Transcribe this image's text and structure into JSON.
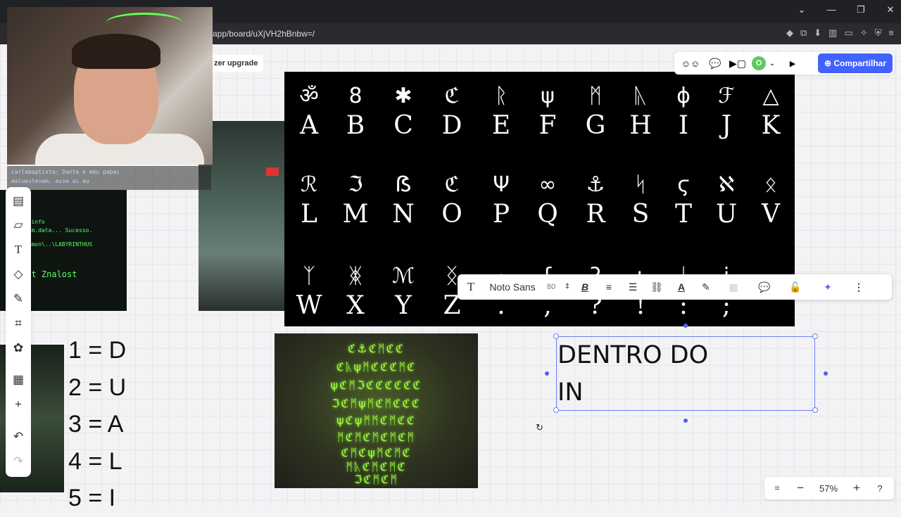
{
  "browser": {
    "url": "app/board/uXjVH2hBnbw=/",
    "window_controls": [
      "⌄",
      "—",
      "❐",
      "✕"
    ],
    "ext_icons": [
      "◆",
      "⧉",
      "⬇",
      "▥",
      "▭",
      "✧",
      "⛨",
      "≡"
    ]
  },
  "board": {
    "upgrade_label": "zer upgrade",
    "share_label": "Compartilhar",
    "avatar_initial": "O",
    "zoom_level": "57%"
  },
  "chat": {
    "line1": "carlabaptista: Dante é meu papai",
    "line2": "maluestevam: esse ai eu"
  },
  "terminal": {
    "lines": [
      "...info",
      "item.data... Sucesso.",
      "common\\..\\LABYRINTHUS"
    ],
    "big_text": "ost Znalost"
  },
  "mapping": {
    "lines": [
      "1 = D",
      "2 = U",
      "3 = A",
      "4 = L",
      "5 = I"
    ]
  },
  "alphabet": {
    "row1": [
      {
        "g": "ॐ",
        "l": "A"
      },
      {
        "g": "8",
        "l": "B"
      },
      {
        "g": "✱",
        "l": "C"
      },
      {
        "g": "ℭ",
        "l": "D"
      },
      {
        "g": "ᚱ",
        "l": "E"
      },
      {
        "g": "ψ",
        "l": "F"
      },
      {
        "g": "ᛗ",
        "l": "G"
      },
      {
        "g": "ᚣ",
        "l": "H"
      },
      {
        "g": "ϕ",
        "l": "I"
      },
      {
        "g": "ℱ",
        "l": "J"
      },
      {
        "g": "△",
        "l": "K"
      }
    ],
    "row2": [
      {
        "g": "ℛ",
        "l": "L"
      },
      {
        "g": "ℑ",
        "l": "M"
      },
      {
        "g": "ẞ",
        "l": "N"
      },
      {
        "g": "ℭ",
        "l": "O"
      },
      {
        "g": "Ψ",
        "l": "P"
      },
      {
        "g": "∞",
        "l": "Q"
      },
      {
        "g": "⚓",
        "l": "R"
      },
      {
        "g": "ᛋ",
        "l": "S"
      },
      {
        "g": "ϛ",
        "l": "T"
      },
      {
        "g": "ℵ",
        "l": "U"
      },
      {
        "g": "ᛟ",
        "l": "V"
      }
    ],
    "row3": [
      {
        "g": "ᛉ",
        "l": "W"
      },
      {
        "g": "ᛤ",
        "l": "X"
      },
      {
        "g": "ℳ",
        "l": "Y"
      },
      {
        "g": "ᛝ",
        "l": "Z"
      },
      {
        "g": "·",
        "l": "."
      },
      {
        "g": "ʆ",
        "l": ","
      },
      {
        "g": "ʔ",
        "l": "?"
      },
      {
        "g": "ɩ",
        "l": "!"
      },
      {
        "g": "ᛦ",
        "l": ":"
      },
      {
        "g": "ɉ",
        "l": ";"
      }
    ]
  },
  "runes": {
    "rows": [
      "ℭ⚓ℭᛗℭℭ",
      "ℭᚣψᛗℭℭℭᛗℭ",
      "ψℭᛗℑℭℭℭℭℭℭ",
      "ℑℭᛗψᛗℭᛗℭℭℭ",
      "ψℭψᛗᛗℭᛗℭℭ",
      "ᛗℭᛗℭᛗℭᛗℭᛗ",
      "ℭᛗℭψᛗℭᛗℭ",
      "ᛗᚣℭᛗℭᛗℭ",
      "ℑℭᛗℭᛗ"
    ]
  },
  "format_bar": {
    "font_name": "Noto Sans",
    "font_size": "80"
  },
  "text_box": {
    "content": "DENTRO DO\nIN"
  }
}
